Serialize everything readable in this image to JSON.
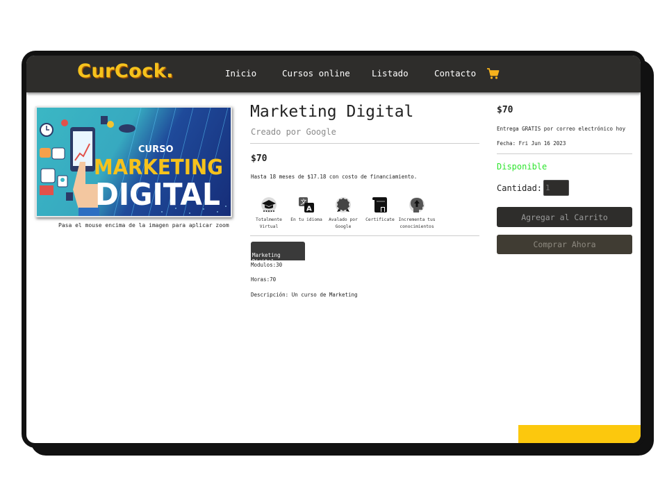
{
  "brand": {
    "logo_text": "CurCock.",
    "accent": "#f6c21c"
  },
  "nav": {
    "items": [
      {
        "label": "Inicio"
      },
      {
        "label": "Cursos online"
      },
      {
        "label": "Listado"
      },
      {
        "label": "Contacto"
      }
    ],
    "cart_icon": "shopping-cart-icon"
  },
  "product": {
    "image": {
      "alt": "Curso Marketing Digital",
      "badge": "CURSO",
      "line1": "MARKETING",
      "line2": "DIGITAL"
    },
    "image_caption": "Pasa el mouse encima de la imagen para aplicar zoom",
    "title": "Marketing Digital",
    "creator": "Creado por Google",
    "price": "$70",
    "financing": "Hasta 18 meses de $17.18 con costo de financiamiento.",
    "features": [
      {
        "icon": "graduation-cap-icon",
        "label": "Totalmente Virtual"
      },
      {
        "icon": "translate-icon",
        "label": "En tu idioma"
      },
      {
        "icon": "award-badge-icon",
        "label": "Avalado por Google"
      },
      {
        "icon": "certificate-scroll-icon",
        "label": "Certificate"
      },
      {
        "icon": "head-arrow-icon",
        "label": "Incrementa tus conocimientos"
      }
    ],
    "tab_label": "Marketing Digital",
    "details": {
      "modulos": "Modulos:30",
      "horas": "Horas:70",
      "descripcion": "Descripción: Un curso de Marketing"
    }
  },
  "purchase": {
    "price": "$70",
    "delivery": "Entrega GRATIS por correo electrónico hoy",
    "date": "Fecha: Fri Jun 16 2023",
    "availability": "Disponible",
    "availability_color": "#2ee52e",
    "quantity_label": "Cantidad:",
    "quantity_placeholder": "1",
    "add_to_cart": "Agregar al Carrito",
    "buy_now": "Comprar Ahora"
  }
}
